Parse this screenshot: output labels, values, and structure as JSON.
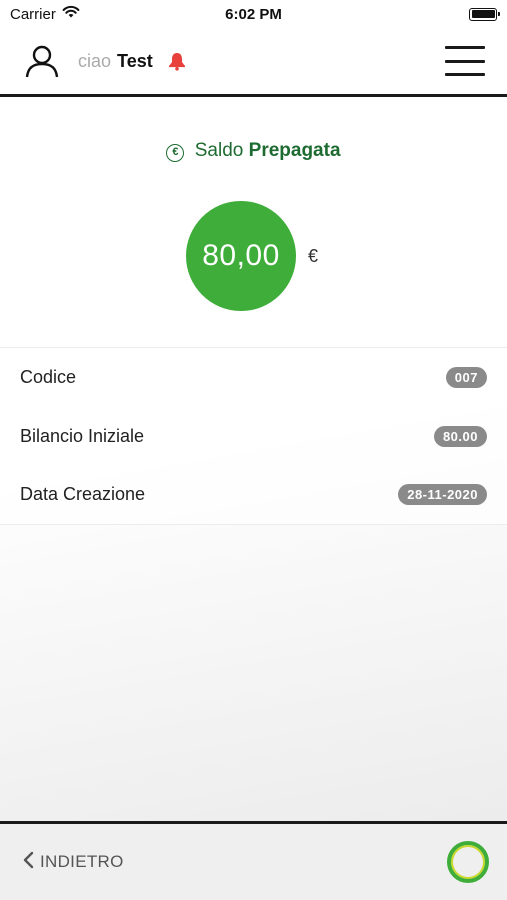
{
  "status_bar": {
    "carrier": "Carrier",
    "time": "6:02 PM"
  },
  "header": {
    "greeting": "ciao",
    "username": "Test"
  },
  "balance": {
    "title_prefix": "Saldo",
    "title_bold": "Prepagata",
    "amount": "80,00",
    "currency": "€",
    "accent_color": "#3ead3a"
  },
  "details": [
    {
      "label": "Codice",
      "value": "007"
    },
    {
      "label": "Bilancio Iniziale",
      "value": "80.00"
    },
    {
      "label": "Data Creazione",
      "value": "28-11-2020"
    }
  ],
  "footer": {
    "back_label": "INDIETRO"
  },
  "icons": {
    "status": [
      "wifi-icon",
      "battery-icon"
    ],
    "header": [
      "user-icon",
      "bell-icon",
      "menu-icon"
    ],
    "balance": "copyright-icon",
    "footer": [
      "chevron-left-icon",
      "loading-ring-icon"
    ]
  }
}
